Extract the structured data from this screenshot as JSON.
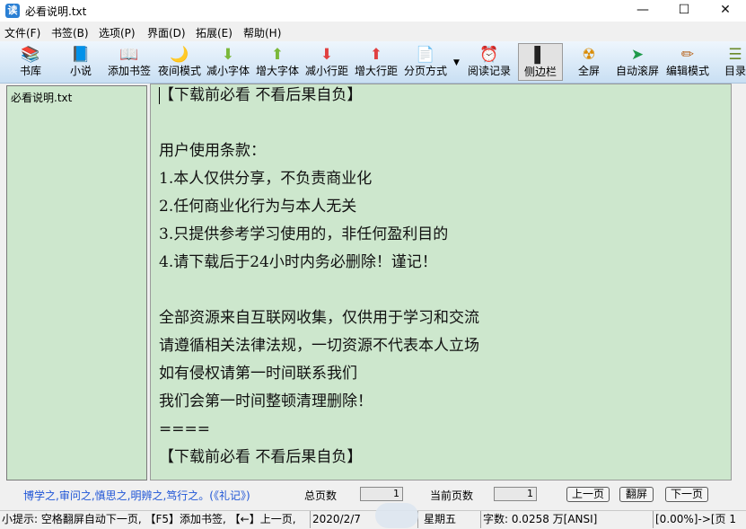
{
  "window": {
    "title": "必看说明.txt",
    "app_icon_glyph": "读",
    "controls": {
      "minimize": "—",
      "maximize": "☐",
      "close": "✕"
    }
  },
  "menu": [
    {
      "label": "文件(F)"
    },
    {
      "label": "书签(B)"
    },
    {
      "label": "选项(P)"
    },
    {
      "label": "界面(D)"
    },
    {
      "label": "拓展(E)"
    },
    {
      "label": "帮助(H)"
    }
  ],
  "toolbar": [
    {
      "label": "书库",
      "icon": "library-icon",
      "glyph": "📚"
    },
    {
      "label": "小说",
      "icon": "novel-icon",
      "glyph": "📘"
    },
    {
      "label": "添加书签",
      "icon": "bookmark-add-icon",
      "glyph": "📖"
    },
    {
      "label": "夜间模式",
      "icon": "night-mode-icon",
      "glyph": "🌙"
    },
    {
      "label": "减小字体",
      "icon": "font-decrease-icon",
      "glyph": "⬇"
    },
    {
      "label": "增大字体",
      "icon": "font-increase-icon",
      "glyph": "⬆"
    },
    {
      "label": "减小行距",
      "icon": "line-spacing-decrease-icon",
      "glyph": "⬇"
    },
    {
      "label": "增大行距",
      "icon": "line-spacing-increase-icon",
      "glyph": "⬆"
    },
    {
      "label": "分页方式",
      "icon": "pagination-icon",
      "glyph": "📄"
    },
    {
      "label": "阅读记录",
      "icon": "reading-history-icon",
      "glyph": "⏰"
    },
    {
      "label": "侧边栏",
      "icon": "sidebar-icon",
      "glyph": "▌"
    },
    {
      "label": "全屏",
      "icon": "fullscreen-icon",
      "glyph": "☢"
    },
    {
      "label": "自动滚屏",
      "icon": "auto-scroll-icon",
      "glyph": "➤"
    },
    {
      "label": "编辑模式",
      "icon": "edit-mode-icon",
      "glyph": "✏"
    },
    {
      "label": "目录",
      "icon": "contents-icon",
      "glyph": "☰"
    }
  ],
  "sidebar": {
    "files": [
      "必看说明.txt"
    ]
  },
  "reader": {
    "lines": [
      "【下载前必看 不看后果自负】",
      "",
      "用户使用条款：",
      "1.本人仅供分享，不负责商业化",
      "2.任何商业化行为与本人无关",
      "3.只提供参考学习使用的，非任何盈利目的",
      "4.请下载后于24小时内务必删除！谨记！",
      "",
      "全部资源来自互联网收集，仅供用于学习和交流",
      "请遵循相关法律法规，一切资源不代表本人立场",
      "如有侵权请第一时间联系我们",
      "我们会第一时间整顿清理删除！",
      "====",
      "【下载前必看 不看后果自负】"
    ]
  },
  "info": {
    "motto": "博学之,审问之,慎思之,明辨之,笃行之。(《礼记》)",
    "total_pages_label": "总页数",
    "total_pages": "1",
    "current_page_label": "当前页数",
    "current_page": "1",
    "prev_page": "上一页",
    "flip_page": "翻屏",
    "next_page": "下一页"
  },
  "status": {
    "tip": "小提示: 空格翻屏自动下一页, 【F5】添加书签, 【←】上一页,",
    "date": "2020/2/7",
    "weekday": "星期五",
    "word_count": "字数: 0.0258 万[ANSI]",
    "progress": "[0.00%]->[页 1"
  },
  "colors": {
    "reader_bg": "#cde7cd",
    "toolbar_top": "#eef6fd",
    "toolbar_bottom": "#c9dff3",
    "motto": "#1f55d6"
  }
}
